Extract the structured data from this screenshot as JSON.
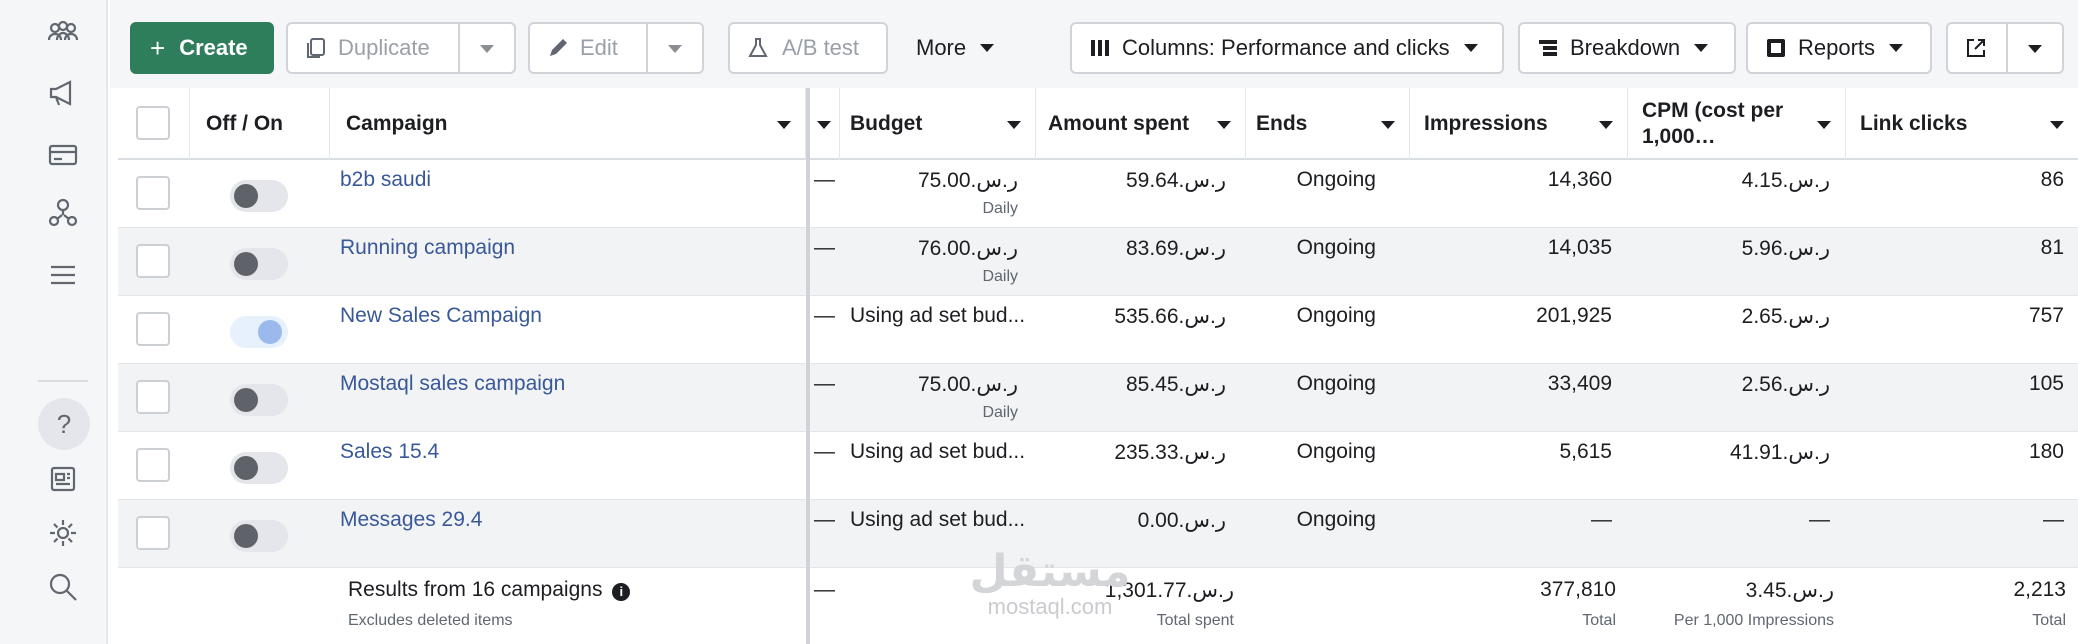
{
  "toolbar": {
    "create_label": "Create",
    "duplicate_label": "Duplicate",
    "edit_label": "Edit",
    "ab_test_label": "A/B test",
    "more_label": "More",
    "columns_label": "Columns: Performance and clicks",
    "breakdown_label": "Breakdown",
    "reports_label": "Reports"
  },
  "table": {
    "headers": {
      "off_on": "Off / On",
      "campaign": "Campaign",
      "budget": "Budget",
      "amount_spent": "Amount spent",
      "ends": "Ends",
      "impressions": "Impressions",
      "cpm": "CPM (cost per 1,000…",
      "link_clicks": "Link clicks"
    },
    "rows": [
      {
        "name": "b2b saudi",
        "dash": "—",
        "budget": "ر.س.75.00",
        "budget_sub": "Daily",
        "spent": "ر.س.59.64",
        "ends": "Ongoing",
        "impressions": "14,360",
        "cpm": "ر.س.4.15",
        "clicks": "86",
        "on": false
      },
      {
        "name": "Running campaign",
        "dash": "—",
        "budget": "ر.س.76.00",
        "budget_sub": "Daily",
        "spent": "ر.س.83.69",
        "ends": "Ongoing",
        "impressions": "14,035",
        "cpm": "ر.س.5.96",
        "clicks": "81",
        "on": false
      },
      {
        "name": "New Sales Campaign",
        "dash": "—",
        "budget": "Using ad set bud...",
        "budget_sub": "",
        "spent": "ر.س.535.66",
        "ends": "Ongoing",
        "impressions": "201,925",
        "cpm": "ر.س.2.65",
        "clicks": "757",
        "on": true
      },
      {
        "name": "Mostaql sales campaign",
        "dash": "—",
        "budget": "ر.س.75.00",
        "budget_sub": "Daily",
        "spent": "ر.س.85.45",
        "ends": "Ongoing",
        "impressions": "33,409",
        "cpm": "ر.س.2.56",
        "clicks": "105",
        "on": false
      },
      {
        "name": "Sales 15.4",
        "dash": "—",
        "budget": "Using ad set bud...",
        "budget_sub": "",
        "spent": "ر.س.235.33",
        "ends": "Ongoing",
        "impressions": "5,615",
        "cpm": "ر.س.41.91",
        "clicks": "180",
        "on": false
      },
      {
        "name": "Messages 29.4",
        "dash": "—",
        "budget": "Using ad set bud...",
        "budget_sub": "",
        "spent": "ر.س.0.00",
        "ends": "Ongoing",
        "impressions": "—",
        "cpm": "—",
        "clicks": "—",
        "on": false
      }
    ],
    "footer": {
      "results": "Results from 16 campaigns",
      "excludes": "Excludes deleted items",
      "dash": "—",
      "spent": "ر.س.1,301.77",
      "spent_sub": "Total spent",
      "impressions": "377,810",
      "impressions_sub": "Total",
      "cpm": "ر.س.3.45",
      "cpm_sub": "Per 1,000 Impressions",
      "clicks": "2,213",
      "clicks_sub": "Total"
    }
  },
  "watermark": {
    "arabic": "مستقل",
    "latin": "mostaql.com"
  },
  "icons": [
    "people-icon",
    "megaphone-icon",
    "card-icon",
    "audience-icon",
    "menu-icon",
    "help-icon",
    "news-icon",
    "gear-icon",
    "search-icon",
    "duplicate-icon",
    "edit-icon",
    "flask-icon",
    "columns-icon",
    "breakdown-icon",
    "reports-icon",
    "export-icon"
  ],
  "colors": {
    "create": "#2e7d5b",
    "link": "#385898",
    "toggle_on": "#9cb9ee"
  }
}
